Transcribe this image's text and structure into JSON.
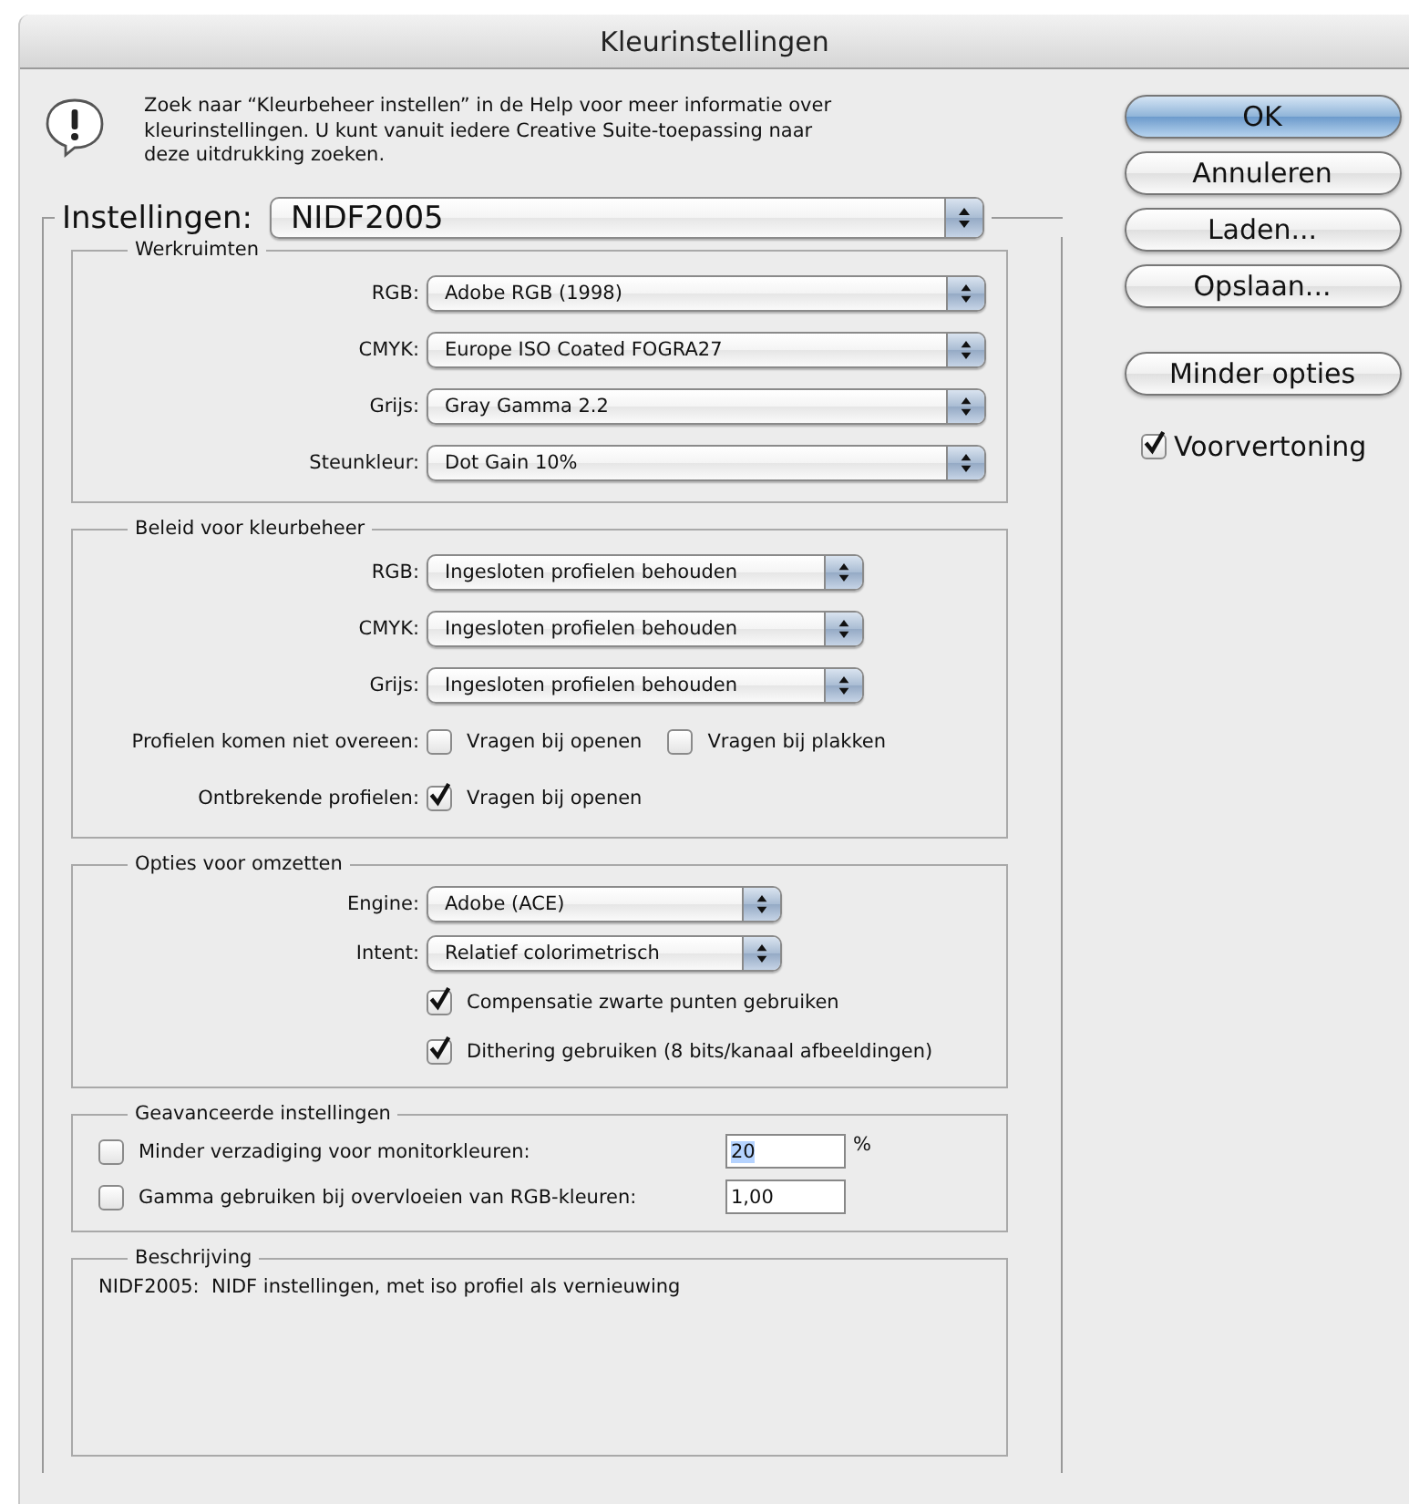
{
  "window": {
    "title": "Kleurinstellingen"
  },
  "help_text": "Zoek naar “Kleurbeheer instellen” in de Help voor meer informatie over kleurinstellingen. U kunt vanuit iedere Creative Suite-toepassing naar deze uitdrukking zoeken.",
  "settings": {
    "label": "Instellingen:",
    "value": "NIDF2005"
  },
  "groups": [
    {
      "title": "Werkruimten",
      "kind": "workspaces",
      "rows": [
        {
          "kind": "select",
          "label": "RGB:",
          "value": "Adobe RGB (1998)"
        },
        {
          "kind": "select",
          "label": "CMYK:",
          "value": "Europe ISO Coated FOGRA27"
        },
        {
          "kind": "select",
          "label": "Grijs:",
          "value": "Gray Gamma 2.2"
        },
        {
          "kind": "select",
          "label": "Steunkleur:",
          "value": "Dot Gain 10%"
        }
      ]
    },
    {
      "title": "Beleid voor kleurbeheer",
      "kind": "policy",
      "rows": [
        {
          "kind": "select",
          "label": "RGB:",
          "value": "Ingesloten profielen behouden"
        },
        {
          "kind": "select",
          "label": "CMYK:",
          "value": "Ingesloten profielen behouden"
        },
        {
          "kind": "select",
          "label": "Grijs:",
          "value": "Ingesloten profielen behouden"
        },
        {
          "kind": "checks",
          "label": "Profielen komen niet overeen:",
          "options": [
            {
              "label": "Vragen bij openen",
              "checked": false
            },
            {
              "label": "Vragen bij plakken",
              "checked": false
            }
          ]
        },
        {
          "kind": "checks",
          "label": "Ontbrekende profielen:",
          "options": [
            {
              "label": "Vragen bij openen",
              "checked": true
            }
          ]
        }
      ]
    },
    {
      "title": "Opties voor omzetten",
      "kind": "conversion",
      "rows": [
        {
          "kind": "select",
          "label": "Engine:",
          "value": "Adobe (ACE)"
        },
        {
          "kind": "select",
          "label": "Intent:",
          "value": "Relatief colorimetrisch"
        },
        {
          "kind": "checks",
          "options": [
            {
              "label": "Compensatie zwarte punten gebruiken",
              "checked": true
            }
          ]
        },
        {
          "kind": "checks",
          "options": [
            {
              "label": "Dithering gebruiken (8 bits/kanaal afbeeldingen)",
              "checked": true
            }
          ]
        }
      ]
    },
    {
      "title": "Geavanceerde instellingen",
      "kind": "advanced",
      "rows": [
        {
          "kind": "field",
          "label": "Minder verzadiging voor monitorkleuren:",
          "checked": false,
          "value": "20",
          "text_selected": true,
          "unit": "%"
        },
        {
          "kind": "field",
          "label": "Gamma gebruiken bij overvloeien van RGB-kleuren:",
          "checked": false,
          "value": "1,00",
          "text_selected": false
        }
      ]
    },
    {
      "title": "Beschrijving",
      "kind": "description",
      "text": "NIDF2005:  NIDF instellingen, met iso profiel als vernieuwing"
    }
  ],
  "buttons": [
    {
      "label": "OK",
      "default": true
    },
    {
      "label": "Annuleren",
      "default": false
    },
    {
      "label": "Laden...",
      "default": false
    },
    {
      "label": "Opslaan...",
      "default": false
    },
    {
      "label": "Minder opties",
      "default": false
    }
  ],
  "preview": {
    "label": "Voorvertoning",
    "checked": true
  }
}
